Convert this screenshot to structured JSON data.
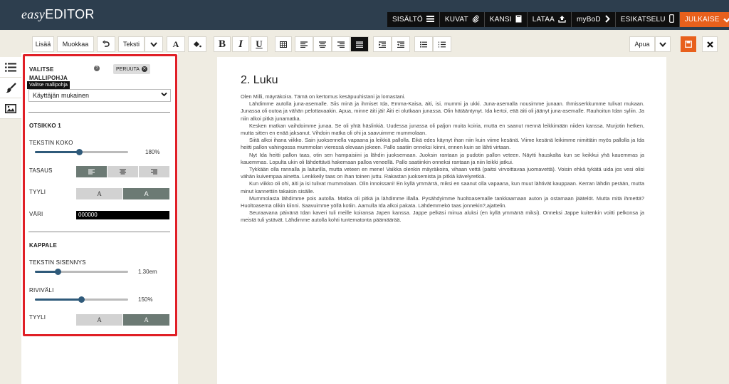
{
  "app": {
    "logo_easy": "easy",
    "logo_editor": "EDITOR"
  },
  "topnav": [
    {
      "label": "SISÄLTÖ",
      "icon": "list-icon"
    },
    {
      "label": "KUVAT",
      "icon": "paperclip-icon"
    },
    {
      "label": "KANSI",
      "icon": "book-icon"
    },
    {
      "label": "LATAA",
      "icon": "upload-icon"
    },
    {
      "label": "myBoD",
      "icon": "chevron-right-icon"
    },
    {
      "label": "ESIKATSELU",
      "icon": "phone-icon"
    },
    {
      "label": "JULKAISE",
      "icon": "check-icon",
      "highlight": "#e8601c"
    }
  ],
  "toolbar": {
    "add_label": "Lisää",
    "edit_label": "Muokkaa",
    "style_select": "Teksti",
    "help_select": "Apua"
  },
  "panel": {
    "select_template_label": "VALITSE MALLIPOHJA",
    "cancel_label": "PERUUTA",
    "tooltip": "Valitse mallipohja",
    "template_value": "Käyttäjän mukainen",
    "heading_section": "OTSIKKO 1",
    "text_size_label": "TEKSTIN KOKO",
    "text_size_value": "180%",
    "text_size_level": 0.48,
    "alignment_label": "TASAUS",
    "style_label": "TYYLI",
    "style_a": "A",
    "style_b": "A",
    "color_label": "VÄRI",
    "color_value": "000000",
    "paragraph_section": "KAPPALE",
    "indent_label": "TEKSTIN SISENNYS",
    "indent_value": "1.30em",
    "indent_level": 0.25,
    "line_height_label": "RIVIVÄLI",
    "line_height_value": "150%",
    "line_height_level": 0.5,
    "para_style_label": "TYYLI",
    "para_style_a": "A",
    "para_style_b": "A",
    "accent": "#e01f26"
  },
  "document": {
    "title": "2. Luku",
    "paragraphs": [
      "Olen Milli, mäyräkoira. Tämä on kertomus kesäpuuhistani ja lomastani.",
      "Lähdimme autolla juna-asemalle. Siis minä ja ihmiset Ida, Emma-Kaisa, äiti, isi, mummi ja ukki. Juna-asemalla nousimme junaan. Ihmisserkkumme tulivat mukaan. Junassa oli outoa ja vähän pelottavaakin. Apua, minne äiti jäi! Äiti ei olutkaan junassa. Olin hätääntynyt. Ida kertoi, että äiti oli jäänyt juna-asemalle. Rauhoitun Idan syliin. Ja niin alkoi pitkä junamatka.",
      "Kesken matkan vaihdoimme junaa. Se oli yhtä häslinkiä. Uudessa junassa oli paljon muita koiria, mutta en saanut mennä leikkimään niiden kanssa. Murjotin hetken, mutta sitten en enää jaksanut. Vihdoin matka oli ohi ja saavuimme mummolaan.",
      "Siitä alkoi ihana viikko. Sain juoksennella vapaana ja leikkiä pallolla. Eikä edes käynyt ihan niin kuin viime kesänä. Viime kesänä leikimme nimittäin myös pallolla ja Ida heitti pallon vahingossa mummolan vieressä olevaan jokeen. Pallo saatiin onneksi kiinni, ennen kuin se lähti virtaan.",
      "Nyt Ida heitti pallon taas, otin sen hampaisiini ja lähdin juoksemaan. Juoksin rantaan ja pudotin pallon veteen. Näytti hauskalta kun se keikkui yhä kauemmas ja kauemmas. Lopulta ukin oli lähdettävä hakemaan palloa veneellä. Pallo saatiinkin onneksi rantaan ja niin leikki jatkui.",
      "Tykkään olla rannalla ja laiturilla, mutta veteen en mene! Vaikka olenkin mäyräkoira, vihaan vettä (paitsi virvoittavaa juomavettä). Voisin ehkä tykätä uida jos vesi olisi vähän kuivempaa ainetta. Lenkkeily taas on ihan toinen juttu. Rakastan juoksemista ja pitkiä kävelyretkiä.",
      "Kun viikko oli ohi, äiti ja isi tulivat mummolaan. Olin innoissani! En kyllä ymmärrä, miksi en saanut olla vapaana, kun muut lähtivät kauppaan. Kerran lähdin perään, mutta minut kannettiin takaisin sisälle.",
      "Mummolasta lähdimme pois autolla. Matka oli pitkä ja lähdimme illalla. Pysähdyimme huoltoasemalle tankkaamaan auton ja ostamaan jäätelöt. Mutta mitä ihmettä? Huoltoasema olikin kiinni. Saavuimme yöllä kotiin. Aamulla Ida alkoi pakata. Lähdemmekö taas jonnekin?,ajattelin.",
      "Seuraavana päivänä Idan kaveri tuli meille koiransa Japen kanssa. Jappe pelkäsi minua aluksi (en kyllä ymmärrä miksi). Onneksi Jappe kuitenkin voitti pelkonsa ja meistä tuli ystävät. Lähdimme autolla kohti tuntematonta päämäärää."
    ]
  }
}
